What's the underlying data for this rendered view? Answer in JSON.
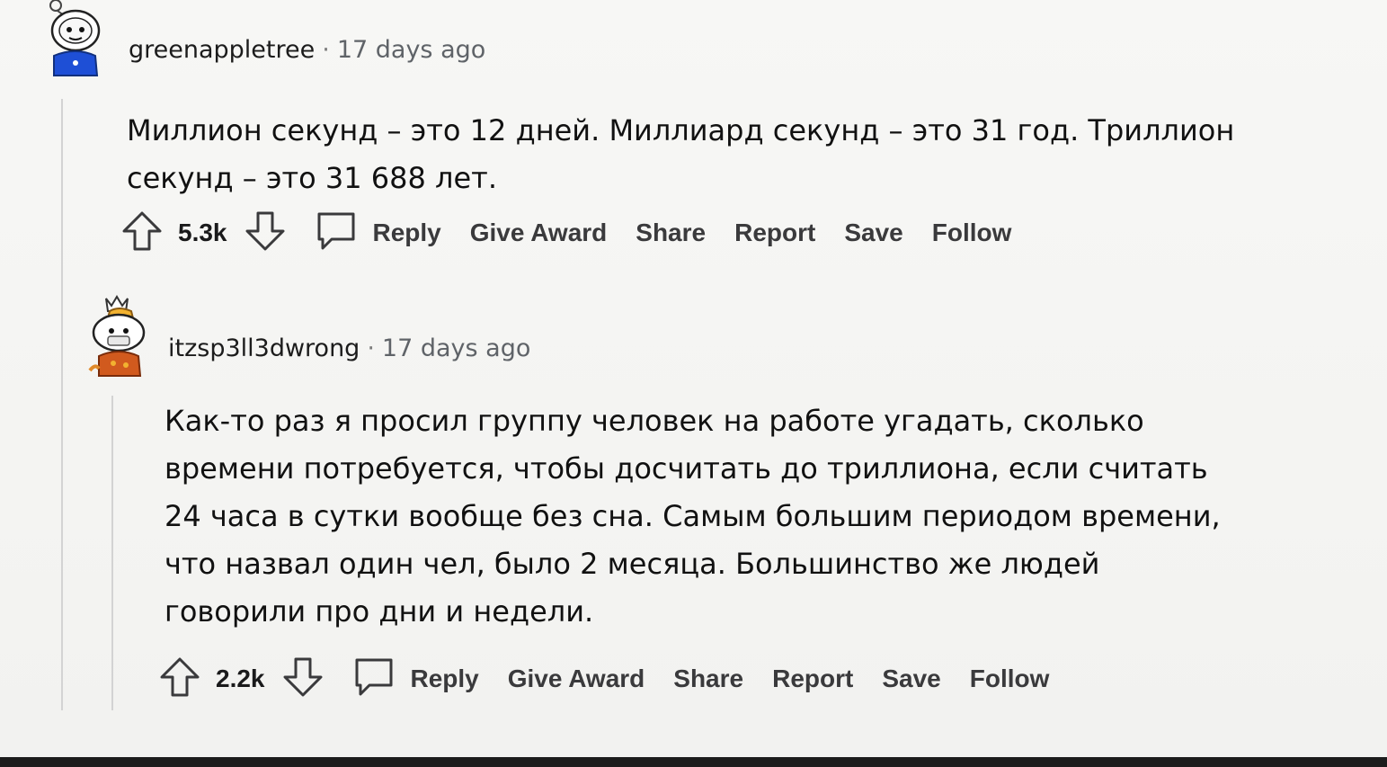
{
  "comments": [
    {
      "username": "greenappletree",
      "separator": "·",
      "time": "17 days ago",
      "lines": [
        "Миллион секунд – это 12 дней. Миллиард секунд – это 31 год. Триллион",
        "секунд – это 31 688 лет."
      ],
      "score": "5.3k",
      "avatar_icon": "snoo-avatar-white-blue",
      "actions": {
        "reply": "Reply",
        "give_award": "Give Award",
        "share": "Share",
        "report": "Report",
        "save": "Save",
        "follow": "Follow"
      }
    },
    {
      "username": "itzsp3ll3dwrong",
      "separator": "·",
      "time": "17 days ago",
      "lines": [
        "Как-то раз я просил группу человек на работе угадать, сколько",
        "времени потребуется, чтобы досчитать до триллиона, если считать",
        "24 часа в сутки вообще без сна. Самым большим периодом времени,",
        "что назвал один чел, было 2 месяца. Большинство же людей",
        "говорили про дни и недели."
      ],
      "score": "2.2k",
      "avatar_icon": "snoo-avatar-crown-orange",
      "actions": {
        "reply": "Reply",
        "give_award": "Give Award",
        "share": "Share",
        "report": "Report",
        "save": "Save",
        "follow": "Follow"
      }
    }
  ],
  "icons": {
    "upvote": "upvote-arrow-icon",
    "downvote": "downvote-arrow-icon",
    "reply": "speech-bubble-icon"
  },
  "colors": {
    "action_text": "#3a3a3c",
    "thread_line": "#d3d3d3"
  }
}
